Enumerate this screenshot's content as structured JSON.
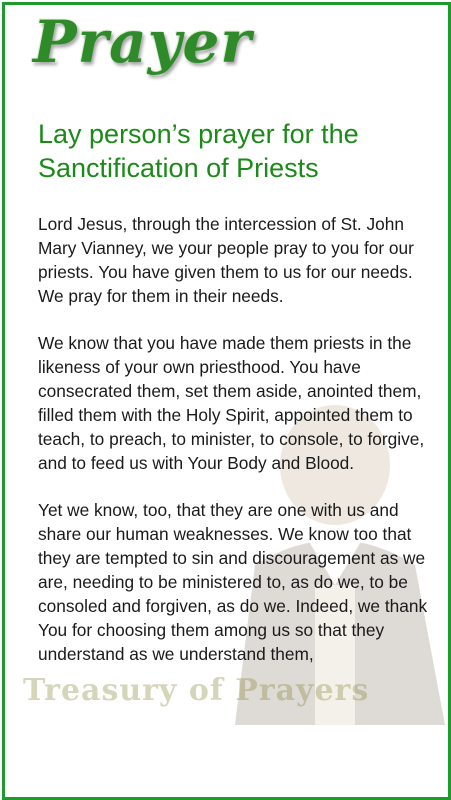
{
  "header": {
    "logo_text": "Prayer"
  },
  "title": "Lay person’s prayer for the Sanctification of Priests",
  "paragraphs": [
    "Lord Jesus, through the intercession of St. John Mary Vianney, we your people pray to you for our priests. You have given them to us for our needs. We pray for them in their needs.",
    "We know that you have made them priests in the likeness of your own priesthood. You have consecrated them, set them aside, anointed them, filled them with the Holy Spirit, appointed them to teach, to preach, to minister, to console, to forgive, and to feed us with Your Body and Blood.",
    "Yet we know, too, that they are one with us and share our human weaknesses. We know too that they are tempted to sin and discouragement as we are, needing to be ministered to, as do we, to be consoled and forgiven, as do we. Indeed, we thank You for choosing them among us so that they understand as we understand them,"
  ],
  "watermark_text": "Treasury of Prayers",
  "colors": {
    "border": "#1f9a2c",
    "title": "#1c8a19",
    "logo": "#2f8a2a",
    "text": "#1a1a1a"
  }
}
